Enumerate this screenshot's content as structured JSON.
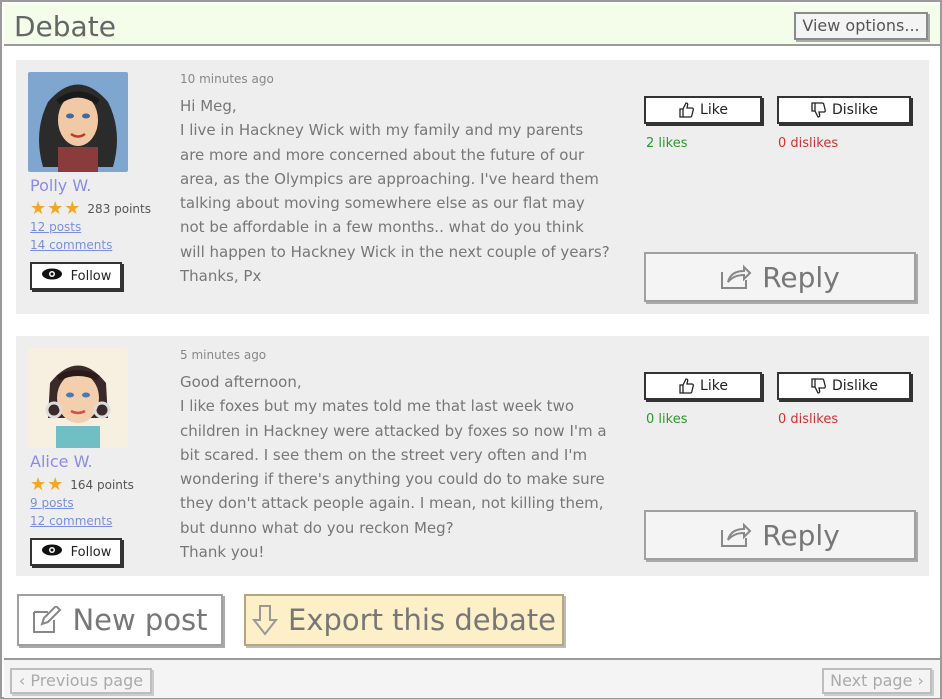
{
  "header": {
    "title": "Debate",
    "view_options_label": "View options..."
  },
  "posts": [
    {
      "user": {
        "name": "Polly W.",
        "stars": 3,
        "points": "283 points",
        "posts_link": "12 posts",
        "comments_link": "14 comments",
        "follow_label": "Follow"
      },
      "time": "10 minutes ago",
      "body": "Hi Meg,\nI live in Hackney Wick with my family and my parents are more and more concerned about the future of our area, as the Olympics are approaching. I've heard them talking about moving somewhere else as our flat may not be affordable in a few months.. what do you think will happen to Hackney Wick in the next couple of years?\nThanks, Px",
      "like_label": "Like",
      "dislike_label": "Dislike",
      "likes": "2 likes",
      "dislikes": "0 dislikes",
      "reply_label": "Reply"
    },
    {
      "user": {
        "name": "Alice W.",
        "stars": 2,
        "points": "164 points",
        "posts_link": "9 posts",
        "comments_link": "12 comments",
        "follow_label": "Follow"
      },
      "time": "5 minutes ago",
      "body": "Good afternoon,\nI like foxes but my mates told me that last week two children in Hackney were attacked by foxes so now I'm a bit scared. I see them on the street very often and I'm wondering if there's anything you could do to make sure they don't attack people again. I mean, not killing them, but dunno what do you reckon Meg?\nThank you!",
      "like_label": "Like",
      "dislike_label": "Dislike",
      "likes": "0 likes",
      "dislikes": "0 dislikes",
      "reply_label": "Reply"
    }
  ],
  "actions": {
    "new_post_label": "New post",
    "export_label": "Export this debate"
  },
  "footer": {
    "prev_label": "‹ Previous page",
    "next_label": "Next page ›"
  },
  "colors": {
    "header_bg": "#f3fdea",
    "export_bg": "#fdefc7",
    "likes": "#2a9a2a",
    "dislikes": "#cc3333",
    "star": "#f5a623",
    "username": "#8a8be8"
  }
}
